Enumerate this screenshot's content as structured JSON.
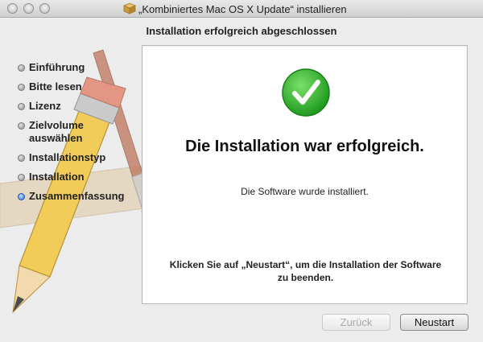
{
  "window": {
    "title": "„Kombiniertes Mac OS X Update“ installieren",
    "icon": "package-icon"
  },
  "header": {
    "subtitle": "Installation erfolgreich abgeschlossen"
  },
  "sidebar": {
    "items": [
      {
        "label": "Einführung",
        "active": false
      },
      {
        "label": "Bitte lesen",
        "active": false
      },
      {
        "label": "Lizenz",
        "active": false
      },
      {
        "label": "Zielvolume auswählen",
        "active": false
      },
      {
        "label": "Installationstyp",
        "active": false
      },
      {
        "label": "Installation",
        "active": false
      },
      {
        "label": "Zusammenfassung",
        "active": true
      }
    ]
  },
  "main": {
    "status_icon": "checkmark-icon",
    "headline": "Die Installation war erfolgreich.",
    "message": "Die Software wurde installiert.",
    "restart_note": "Klicken Sie auf „Neustart“, um die Installation der Software zu beenden."
  },
  "buttons": {
    "back": "Zurück",
    "restart": "Neustart"
  },
  "colors": {
    "accent": "#2a6fd6",
    "success": "#2fb52f"
  }
}
